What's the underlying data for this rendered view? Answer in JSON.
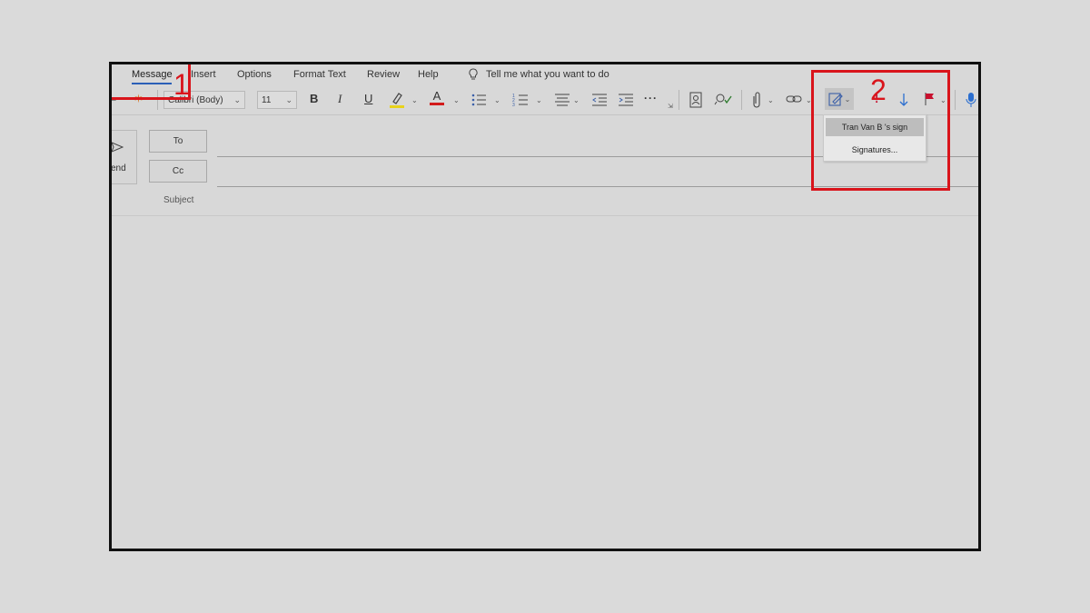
{
  "tabs": [
    "Message",
    "Insert",
    "Options",
    "Format Text",
    "Review",
    "Help"
  ],
  "tell_me": "Tell me what you want to do",
  "toolbar": {
    "font_name": "Calibri (Body)",
    "font_size": "11",
    "bold": "B",
    "italic": "I",
    "underline": "U",
    "font_color": "A",
    "more": "···"
  },
  "compose": {
    "send_label": "end",
    "to_label": "To",
    "cc_label": "Cc",
    "subject_label": "Subject"
  },
  "signature_menu": {
    "items": [
      "Tran Van B 's sign",
      "Signatures..."
    ]
  },
  "annotations": {
    "step1": "1",
    "step2": "2",
    "color": "#d9141b"
  },
  "colors": {
    "highlight_yellow": "#e8d21a",
    "font_red": "#d21b1b",
    "accent_blue": "#2b5fb7",
    "flag_red": "#c8102e"
  }
}
